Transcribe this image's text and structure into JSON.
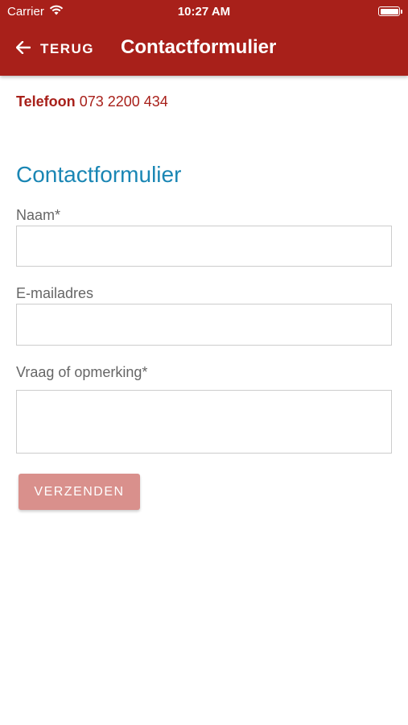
{
  "status_bar": {
    "carrier": "Carrier",
    "time": "10:27 AM"
  },
  "app_bar": {
    "back_label": "TERUG",
    "title": "Contactformulier"
  },
  "contact": {
    "phone_label": "Telefoon",
    "phone_number": "073 2200 434"
  },
  "form": {
    "title": "Contactformulier",
    "name_label": "Naam*",
    "name_value": "",
    "email_label": "E-mailadres",
    "email_value": "",
    "message_label": "Vraag of opmerking*",
    "message_value": "",
    "submit_label": "VERZENDEN"
  },
  "colors": {
    "brand_red": "#a8201a",
    "title_blue": "#1a86b4",
    "submit_disabled": "#d9908c"
  },
  "icons": {
    "back": "arrow-left-icon",
    "wifi": "wifi-icon",
    "battery": "battery-icon"
  }
}
